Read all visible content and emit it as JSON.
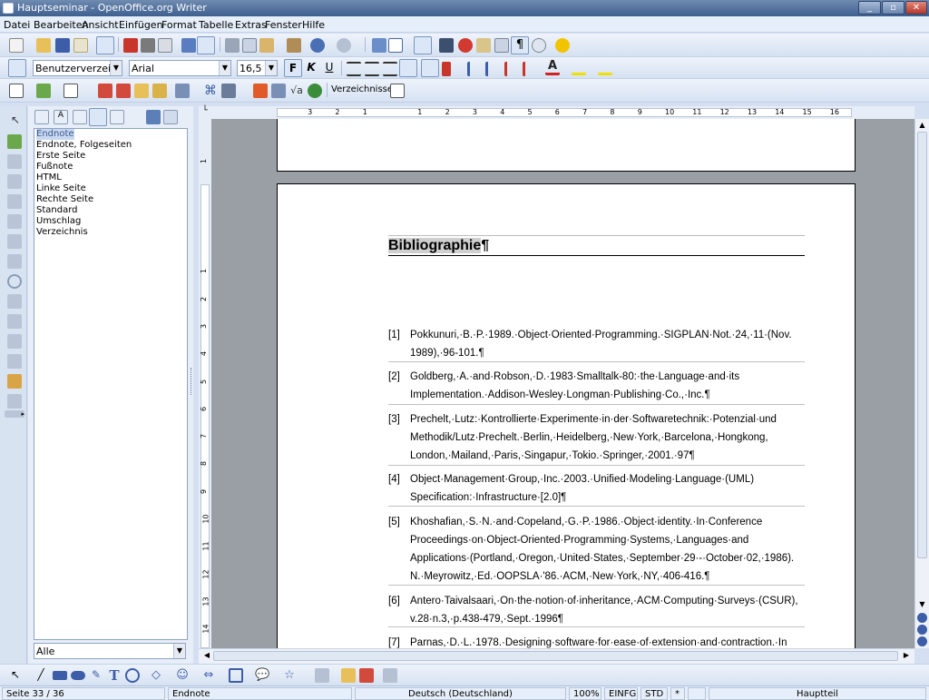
{
  "window": {
    "title": "Hauptseminar - OpenOffice.org Writer"
  },
  "menubar": [
    "Datei",
    "Bearbeiten",
    "Ansicht",
    "Einfügen",
    "Format",
    "Tabelle",
    "Extras",
    "Fenster",
    "Hilfe"
  ],
  "formatting": {
    "paragraph_style": "Benutzerverzeichnis",
    "font_name": "Arial",
    "font_size": "16,5",
    "bold_label": "F",
    "italic_label": "K",
    "underline_label": "U"
  },
  "toolbar3": {
    "index_label": "Verzeichnisse"
  },
  "styles_panel": {
    "items": [
      "Endnote",
      "Endnote, Folgeseiten",
      "Erste Seite",
      "Fußnote",
      "HTML",
      "Linke Seite",
      "Rechte Seite",
      "Standard",
      "Umschlag",
      "Verzeichnis"
    ],
    "selected": "Endnote",
    "filter": "Alle"
  },
  "ruler": {
    "h_labels": [
      "3",
      "2",
      "1",
      "1",
      "2",
      "3",
      "4",
      "5",
      "6",
      "7",
      "8",
      "9",
      "10",
      "11",
      "12",
      "13",
      "14",
      "15",
      "16"
    ],
    "v_labels": [
      "1",
      "1",
      "2",
      "3",
      "4",
      "5",
      "6",
      "7",
      "8",
      "9",
      "10",
      "11",
      "12",
      "13",
      "14"
    ]
  },
  "document": {
    "heading": "Bibliographie",
    "pilcrow": "¶",
    "references": [
      {
        "num": "[1]",
        "text": "Pokkunuri,·B.·P.·1989.·Object·Oriented·Programming.·SIGPLAN·Not.·24,·11·(Nov. 1989),·96-101.¶"
      },
      {
        "num": "[2]",
        "text": "Goldberg,·A.·and·Robson,·D.·1983·Smalltalk-80:·the·Language·and·its Implementation.·Addison-Wesley·Longman·Publishing·Co.,·Inc.¶"
      },
      {
        "num": "[3]",
        "text": "Prechelt,·Lutz:·Kontrollierte·Experimente·in·der·Softwaretechnik:·Potenzial·und Methodik/Lutz·Prechelt.·Berlin,·Heidelberg,·New·York,·Barcelona,·Hongkong, London,·Mailand,·Paris,·Singapur,·Tokio.·Springer,·2001.·97¶"
      },
      {
        "num": "[4]",
        "text": "Object·Management·Group,·Inc.·2003.·Unified·Modeling·Language·(UML) Specification:·Infrastructure·[2.0]¶"
      },
      {
        "num": "[5]",
        "text": "Khoshafian,·S.·N.·and·Copeland,·G.·P.·1986.·Object·identity.·In·Conference Proceedings·on·Object-Oriented·Programming·Systems,·Languages·and Applications·(Portland,·Oregon,·United·States,·September·29·-·October·02,·1986). N.·Meyrowitz,·Ed.·OOPSLA·'86.·ACM,·New·York,·NY,·406-416.¶"
      },
      {
        "num": "[6]",
        "text": "Antero·Taivalsaari,·On·the·notion·of·inheritance,·ACM·Computing·Surveys·(CSUR), v.28·n.3,·p.438-479,·Sept.·1996¶"
      },
      {
        "num": "[7]",
        "text": "Parnas,·D.·L.·1978.·Designing·software·for·ease·of·extension·and·contraction.·In"
      }
    ]
  },
  "status": {
    "page": "Seite 33 / 36",
    "page_style": "Endnote",
    "language": "Deutsch (Deutschland)",
    "zoom": "100%",
    "insert_mode": "EINFG",
    "selection_mode": "STD",
    "modified": "*",
    "section": "Hauptteil"
  },
  "colors": {
    "titlebar": "#4a6a98",
    "workspace": "#9a9ea5",
    "selection": "#c8d8f0"
  }
}
